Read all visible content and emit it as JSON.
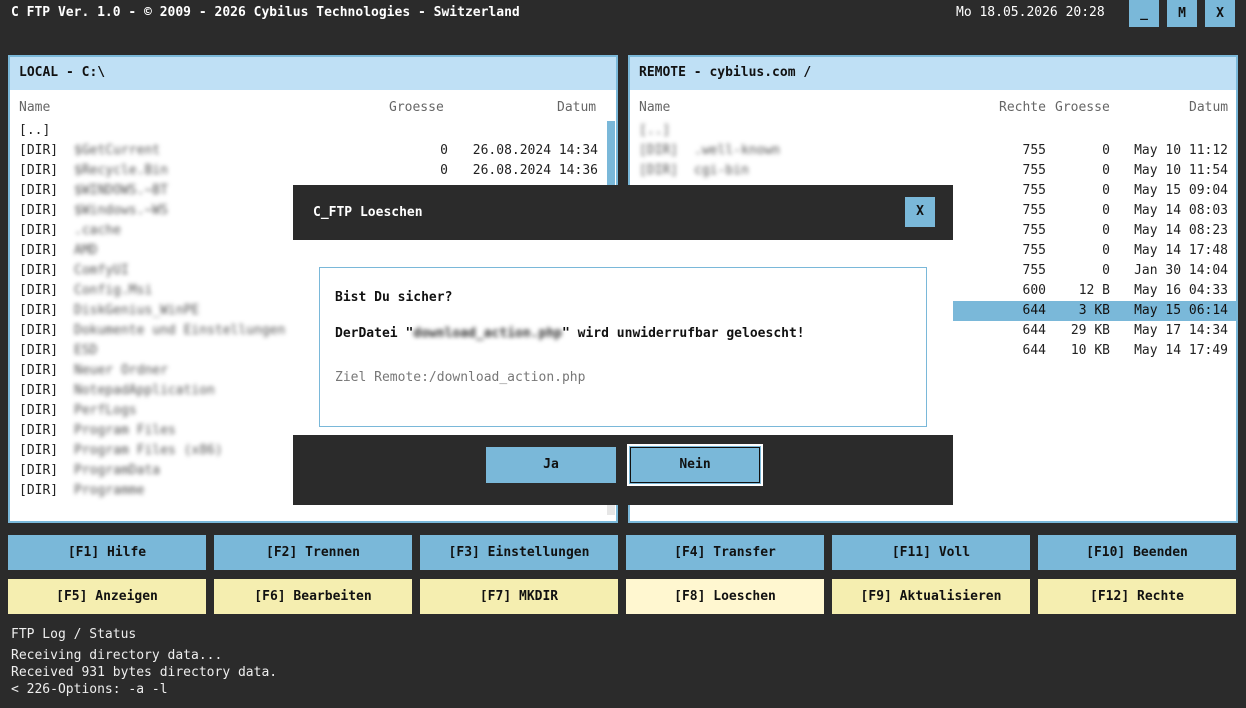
{
  "app": {
    "title": "C FTP Ver. 1.0 - © 2009 - 2026 Cybilus Technologies - Switzerland",
    "datetime": "Mo 18.05.2026   20:28",
    "btn_min": "_",
    "btn_max": "M",
    "btn_close": "X"
  },
  "local": {
    "header": "LOCAL - C:\\",
    "col_name": "Name",
    "col_size": "Groesse",
    "col_date": "Datum",
    "rows": [
      {
        "type": "[..]",
        "name": "",
        "size": "",
        "date": ""
      },
      {
        "type": "[DIR]",
        "name": "$GetCurrent",
        "size": "0",
        "date": "26.08.2024 14:34"
      },
      {
        "type": "[DIR]",
        "name": "$Recycle.Bin",
        "size": "0",
        "date": "26.08.2024 14:36"
      },
      {
        "type": "[DIR]",
        "name": "$WINDOWS.~BT",
        "size": "",
        "date": ""
      },
      {
        "type": "[DIR]",
        "name": "$Windows.~WS",
        "size": "",
        "date": ""
      },
      {
        "type": "[DIR]",
        "name": ".cache",
        "size": "",
        "date": ""
      },
      {
        "type": "[DIR]",
        "name": "AMD",
        "size": "",
        "date": ""
      },
      {
        "type": "[DIR]",
        "name": "ComfyUI",
        "size": "",
        "date": ""
      },
      {
        "type": "[DIR]",
        "name": "Config.Msi",
        "size": "",
        "date": ""
      },
      {
        "type": "[DIR]",
        "name": "DiskGenius_WinPE",
        "size": "",
        "date": ""
      },
      {
        "type": "[DIR]",
        "name": "Dokumente und Einstellungen",
        "size": "",
        "date": ""
      },
      {
        "type": "[DIR]",
        "name": "ESD",
        "size": "",
        "date": ""
      },
      {
        "type": "[DIR]",
        "name": "Neuer Ordner",
        "size": "",
        "date": ""
      },
      {
        "type": "[DIR]",
        "name": "NotepadApplication",
        "size": "",
        "date": ""
      },
      {
        "type": "[DIR]",
        "name": "PerfLogs",
        "size": "",
        "date": ""
      },
      {
        "type": "[DIR]",
        "name": "Program Files",
        "size": "",
        "date": ""
      },
      {
        "type": "[DIR]",
        "name": "Program Files (x86)",
        "size": "",
        "date": ""
      },
      {
        "type": "[DIR]",
        "name": "ProgramData",
        "size": "",
        "date": ""
      },
      {
        "type": "[DIR]",
        "name": "Programme",
        "size": "",
        "date": ""
      }
    ]
  },
  "remote": {
    "header": "REMOTE - cybilus.com  /",
    "col_name": "Name",
    "col_rights": "Rechte",
    "col_size": "Groesse",
    "col_date": "Datum",
    "rows": [
      {
        "type": "[..]",
        "name": "",
        "rights": "",
        "size": "",
        "date": ""
      },
      {
        "type": "[DIR]",
        "name": ".well-known",
        "rights": "755",
        "size": "0",
        "date": "May 10 11:12"
      },
      {
        "type": "[DIR]",
        "name": "cgi-bin",
        "rights": "755",
        "size": "0",
        "date": "May 10 11:54"
      },
      {
        "type": "",
        "name": "",
        "rights": "755",
        "size": "0",
        "date": "May 15 09:04"
      },
      {
        "type": "",
        "name": "",
        "rights": "755",
        "size": "0",
        "date": "May 14 08:03"
      },
      {
        "type": "",
        "name": "",
        "rights": "755",
        "size": "0",
        "date": "May 14 08:23"
      },
      {
        "type": "",
        "name": "",
        "rights": "755",
        "size": "0",
        "date": "May 14 17:48"
      },
      {
        "type": "",
        "name": "",
        "rights": "755",
        "size": "0",
        "date": "Jan 30 14:04"
      },
      {
        "type": "",
        "name": "",
        "rights": "600",
        "size": "12 B",
        "date": "May 16 04:33"
      },
      {
        "type": "",
        "name": "",
        "rights": "644",
        "size": "3 KB",
        "date": "May 15 06:14"
      },
      {
        "type": "",
        "name": "",
        "rights": "644",
        "size": "29 KB",
        "date": "May 17 14:34"
      },
      {
        "type": "",
        "name": "",
        "rights": "644",
        "size": "10 KB",
        "date": "May 14 17:49"
      }
    ]
  },
  "fkeys_row1": [
    "[F1] Hilfe",
    "[F2] Trennen",
    "[F3] Einstellungen",
    "[F4] Transfer",
    "[F11] Voll",
    "[F10] Beenden"
  ],
  "fkeys_row2": [
    "[F5] Anzeigen",
    "[F6] Bearbeiten",
    "[F7] MKDIR",
    "[F8] Loeschen",
    "[F9] Aktualisieren",
    "[F12] Rechte"
  ],
  "log": {
    "title": "FTP Log / Status",
    "lines": [
      "Receiving directory data...",
      "Received 931 bytes directory data.",
      "< 226-Options: -a -l"
    ]
  },
  "dialog": {
    "title": "C_FTP Loeschen",
    "close": "X",
    "question": "Bist Du sicher?",
    "msg_prefix": "DerDatei \"",
    "msg_file": "download_action.php",
    "msg_suffix": "\" wird unwiderrufbar geloescht!",
    "target": "Ziel Remote:/download_action.php",
    "yes": "Ja",
    "no": "Nein"
  },
  "colors": {
    "accent": "#7ab8d9",
    "header_bg": "#bfe0f5",
    "yellow_btn": "#f5eeb0",
    "dark_bg": "#2b2b2b"
  }
}
